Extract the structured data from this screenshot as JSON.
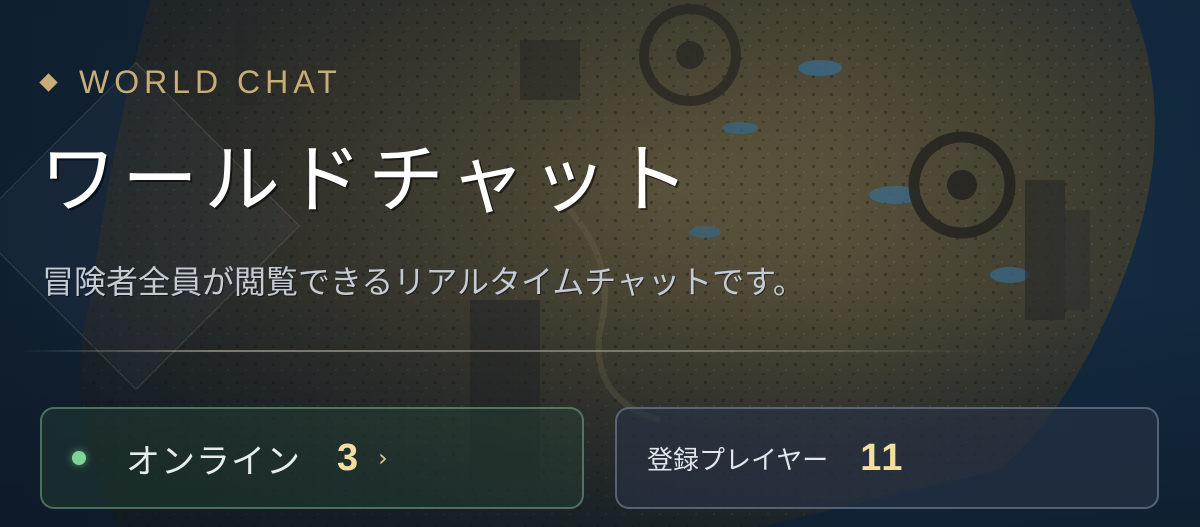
{
  "header": {
    "eyebrow_icon": "gold-diamond-icon",
    "eyebrow": "WORLD CHAT",
    "title": "ワールドチャット",
    "subtitle": "冒険者全員が閲覧できるリアルタイムチャットです。"
  },
  "stats": {
    "online": {
      "label": "オンライン",
      "count": "3",
      "status_color": "#7fd39a",
      "chevron_icon": "chevron-right-icon",
      "chevron": "›"
    },
    "registered": {
      "label": "登録プレイヤー",
      "count": "11"
    }
  },
  "colors": {
    "accent_gold": "#c9ad76",
    "count_gold": "#f2dfa0",
    "online_green": "#7fd39a"
  }
}
